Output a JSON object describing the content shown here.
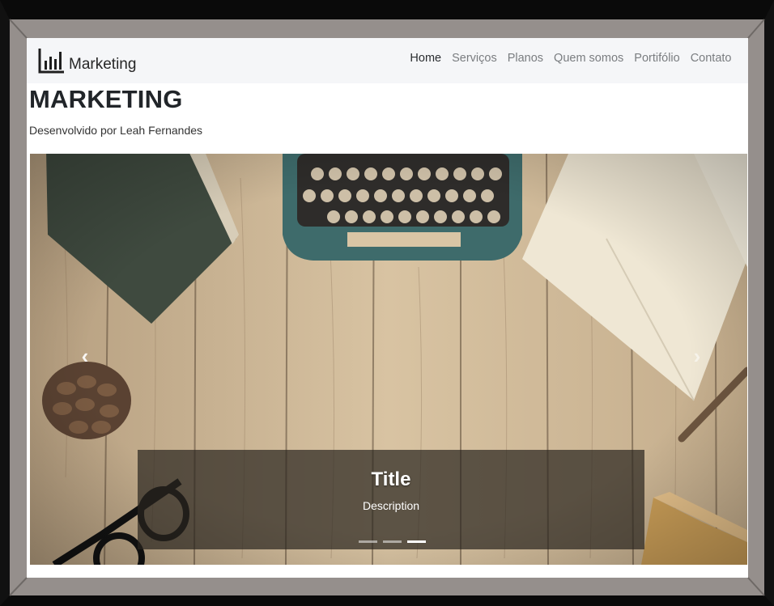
{
  "navbar": {
    "brand": "Marketing",
    "brand_icon": "bar-chart-icon",
    "items": [
      {
        "label": "Home",
        "active": true
      },
      {
        "label": "Serviços",
        "active": false
      },
      {
        "label": "Planos",
        "active": false
      },
      {
        "label": "Quem somos",
        "active": false
      },
      {
        "label": "Portifólio",
        "active": false
      },
      {
        "label": "Contato",
        "active": false
      }
    ]
  },
  "header": {
    "title": "MARKETING",
    "subtitle": "Desenvolvido por Leah Fernandes"
  },
  "carousel": {
    "caption_title": "Title",
    "caption_description": "Description",
    "indicator_count": 3,
    "active_indicator": 3,
    "prev_icon": "chevron-left-icon",
    "next_icon": "chevron-right-icon"
  },
  "colors": {
    "navbar_bg": "#f5f6f8",
    "nav_active": "#2a2d30",
    "nav_inactive": "#7a7d80",
    "frame": "#958f8c"
  }
}
